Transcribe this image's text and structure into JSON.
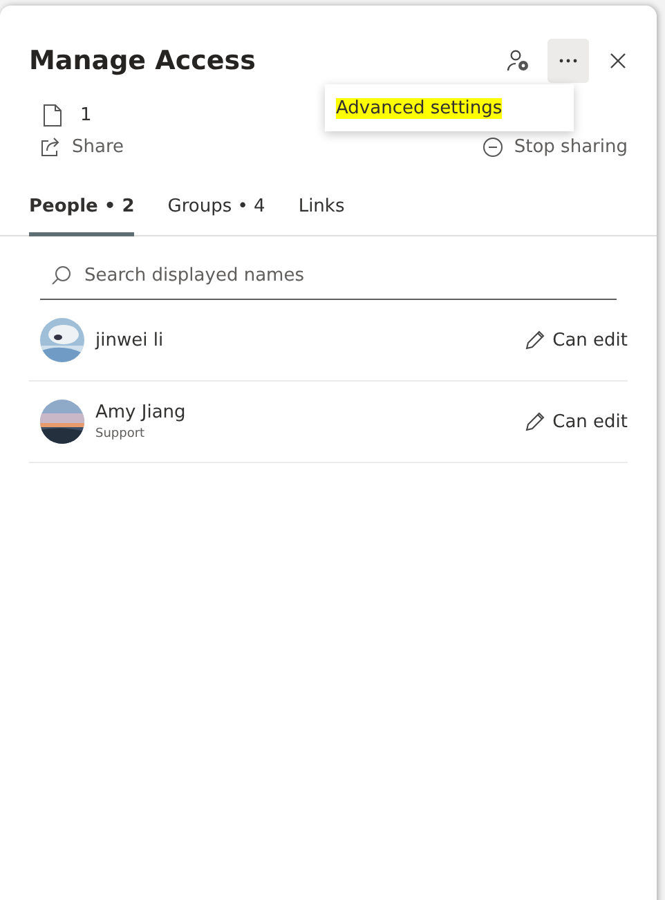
{
  "dialog": {
    "title": "Manage Access",
    "file_count": "1",
    "share": "Share",
    "stop_sharing": "Stop sharing"
  },
  "menu": {
    "items": [
      {
        "label": "Advanced settings",
        "highlighted": true
      }
    ]
  },
  "tabs": [
    {
      "label": "People • 2",
      "selected": true
    },
    {
      "label": "Groups • 4",
      "selected": false
    },
    {
      "label": "Links",
      "selected": false
    }
  ],
  "search": {
    "placeholder": "Search displayed names"
  },
  "people": [
    {
      "name": "jinwei li",
      "permission": "Can edit"
    },
    {
      "name": "Amy Jiang",
      "subtitle": "Support",
      "permission": "Can edit"
    }
  ]
}
